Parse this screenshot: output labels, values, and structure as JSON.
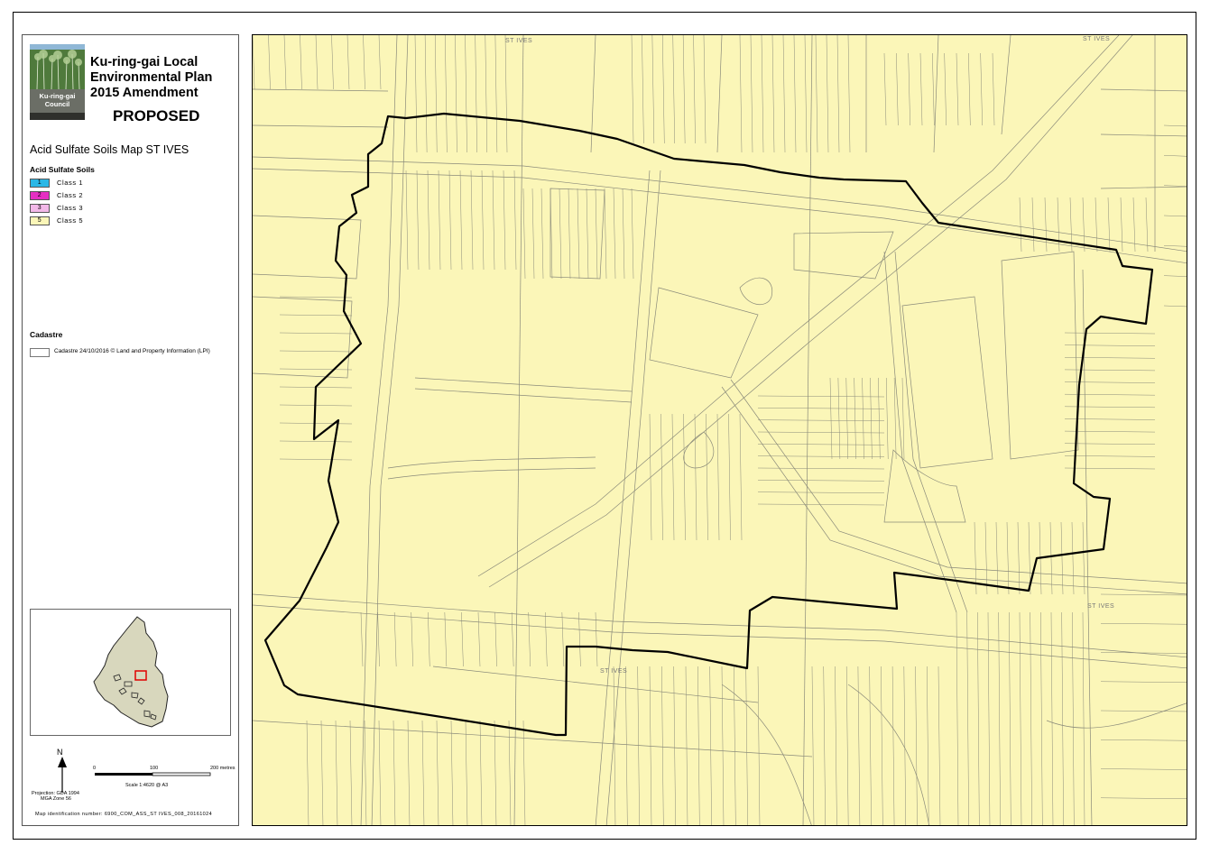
{
  "header": {
    "title_lines": [
      "Ku-ring-gai Local",
      "Environmental Plan",
      "2015 Amendment"
    ],
    "status": "PROPOSED",
    "map_name": "Acid Sulfate Soils Map ST IVES"
  },
  "logo": {
    "label_line1": "Ku-ring-gai",
    "label_line2": "Council",
    "icon": "trees-logo-icon"
  },
  "legend": {
    "title": "Acid Sulfate Soils",
    "classes": [
      {
        "code": "1",
        "label": "Class 1",
        "color": "#2bb8e6"
      },
      {
        "code": "2",
        "label": "Class 2",
        "color": "#e62fc3"
      },
      {
        "code": "3",
        "label": "Class 3",
        "color": "#f2b8e8"
      },
      {
        "code": "5",
        "label": "Class 5",
        "color": "#fbf6b8"
      }
    ],
    "cadastre_title": "Cadastre",
    "cadastre_label": "Cadastre 24/10/2016 © Land and Property Information (LPI)"
  },
  "scale": {
    "north": "N",
    "ticks": [
      "0",
      "100",
      "200 metres"
    ],
    "scale_text": "Scale  1:4620   @ A3",
    "projection_line1": "Projection: GDA 1994",
    "projection_line2": "MGA Zone 56"
  },
  "map_id": "Map identification number:  6900_COM_ASS_ST IVES_008_20161024",
  "place_labels": {
    "top_left": "ST IVES",
    "top_right": "ST IVES",
    "right": "ST IVES",
    "bottom": "ST IVES"
  },
  "colors": {
    "class5_fill": "#fbf6b8",
    "boundary": "#000000",
    "cadastre_lines": "#8a8a7a",
    "inset_lga": "#d8d7bd",
    "inset_marker": "#e00000"
  }
}
